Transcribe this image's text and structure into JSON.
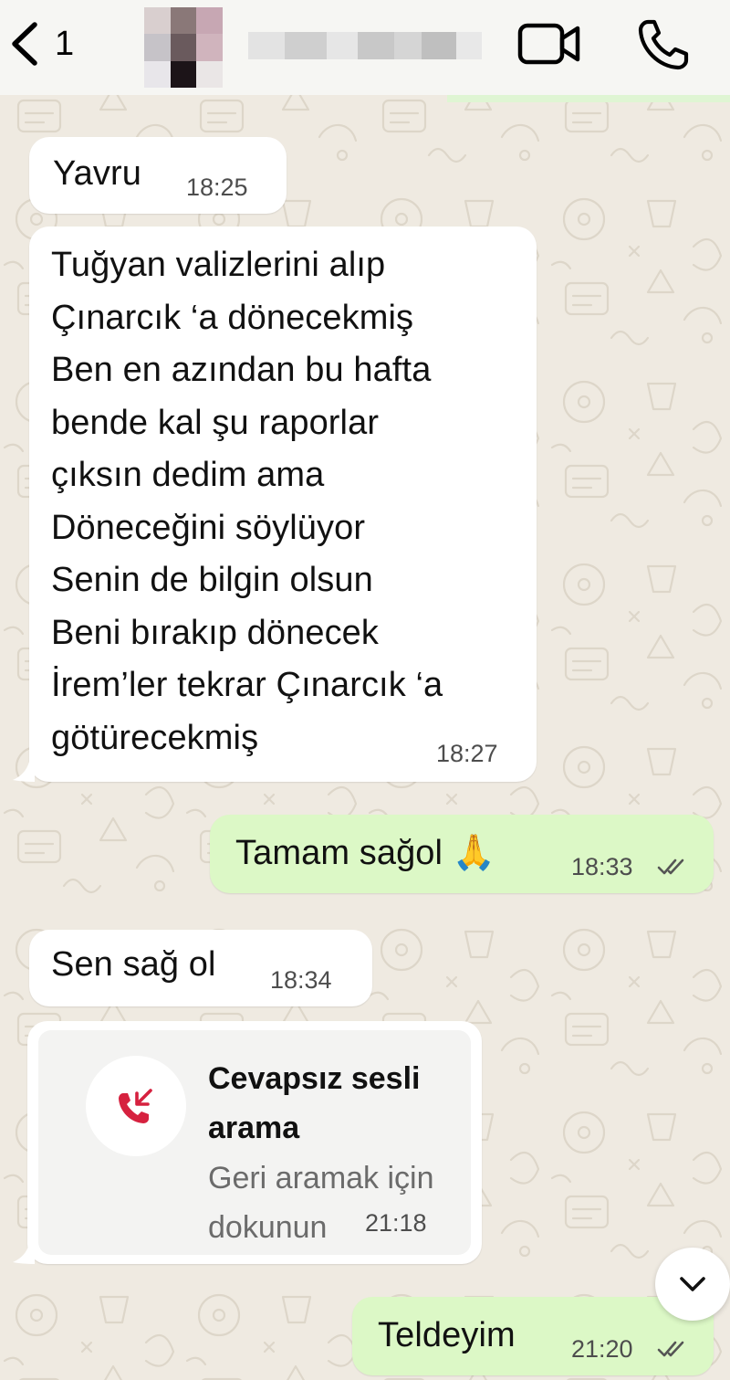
{
  "header": {
    "back_count": "1",
    "contact_avatar": "pixelated-avatar",
    "contact_name": "",
    "video_call_icon": "video-camera-icon",
    "voice_call_icon": "phone-icon"
  },
  "messages": [
    {
      "direction": "incoming",
      "text": "Yavru",
      "time": "18:25"
    },
    {
      "direction": "incoming",
      "text": "Tuğyan valizlerini alıp\nÇınarcık ‘a dönecekmiş\nBen en azından bu hafta\nbende kal şu raporlar\nçıksın dedim ama\nDöneceğini söylüyor\nSenin de bilgin olsun\nBeni bırakıp dönecek\nİrem’ler tekrar Çınarcık ‘a\ngötürecekmiş",
      "time": "18:27"
    },
    {
      "direction": "outgoing",
      "text": "Tamam sağol 🙏",
      "time": "18:33",
      "status": "read"
    },
    {
      "direction": "incoming",
      "text": "Sen sağ ol",
      "time": "18:34"
    },
    {
      "direction": "outgoing",
      "text": "Teldeyim",
      "time": "21:20",
      "status": "read"
    }
  ],
  "missed_call": {
    "title": "Cevapsız sesli\narama",
    "subtitle": "Geri aramak için\ndokunun",
    "time": "21:18",
    "icon": "missed-call-icon",
    "icon_color": "#d6213f"
  },
  "colors": {
    "incoming_bubble": "#ffffff",
    "outgoing_bubble": "#dcf8c6",
    "wallpaper": "#efeae1",
    "header": "#f6f6f3"
  },
  "scroll_down_icon": "chevron-down-icon"
}
